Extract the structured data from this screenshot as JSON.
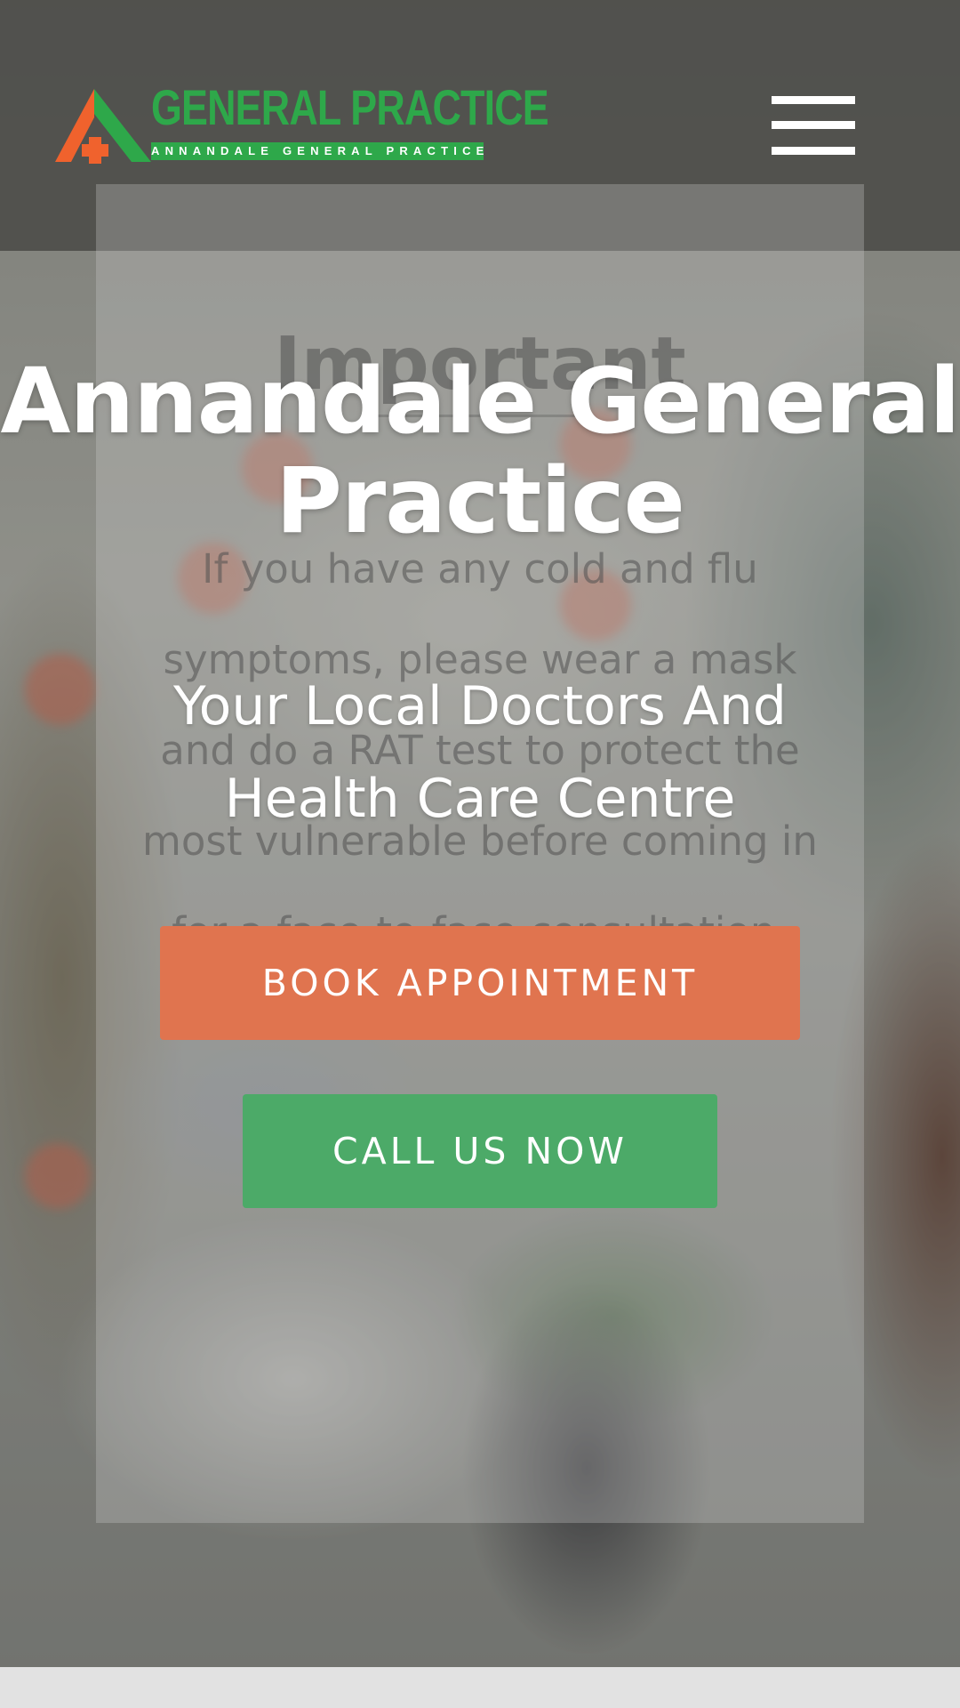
{
  "header": {
    "logo": {
      "title": "GENERAL PRACTICE",
      "tagline": "ANNANDALE GENERAL PRACTICE",
      "colors": {
        "green": "#2ea84a",
        "orange": "#f0622d"
      }
    },
    "menu_icon": "hamburger-menu-icon"
  },
  "background_notice": {
    "heading": "Important",
    "body": "If you have any cold and flu symptoms, please wear a mask and do a RAT test to protect the most vulnerable before coming in for a face-to-face consultation."
  },
  "hero": {
    "title": "Annandale General Practice",
    "subtitle": "Your Local Doctors And Health Care Centre"
  },
  "actions": {
    "book_label": "BOOK APPOINTMENT",
    "call_label": "CALL US NOW"
  },
  "colors": {
    "book_button": "#e0744f",
    "call_button": "#4caa68",
    "text": "#ffffff"
  }
}
